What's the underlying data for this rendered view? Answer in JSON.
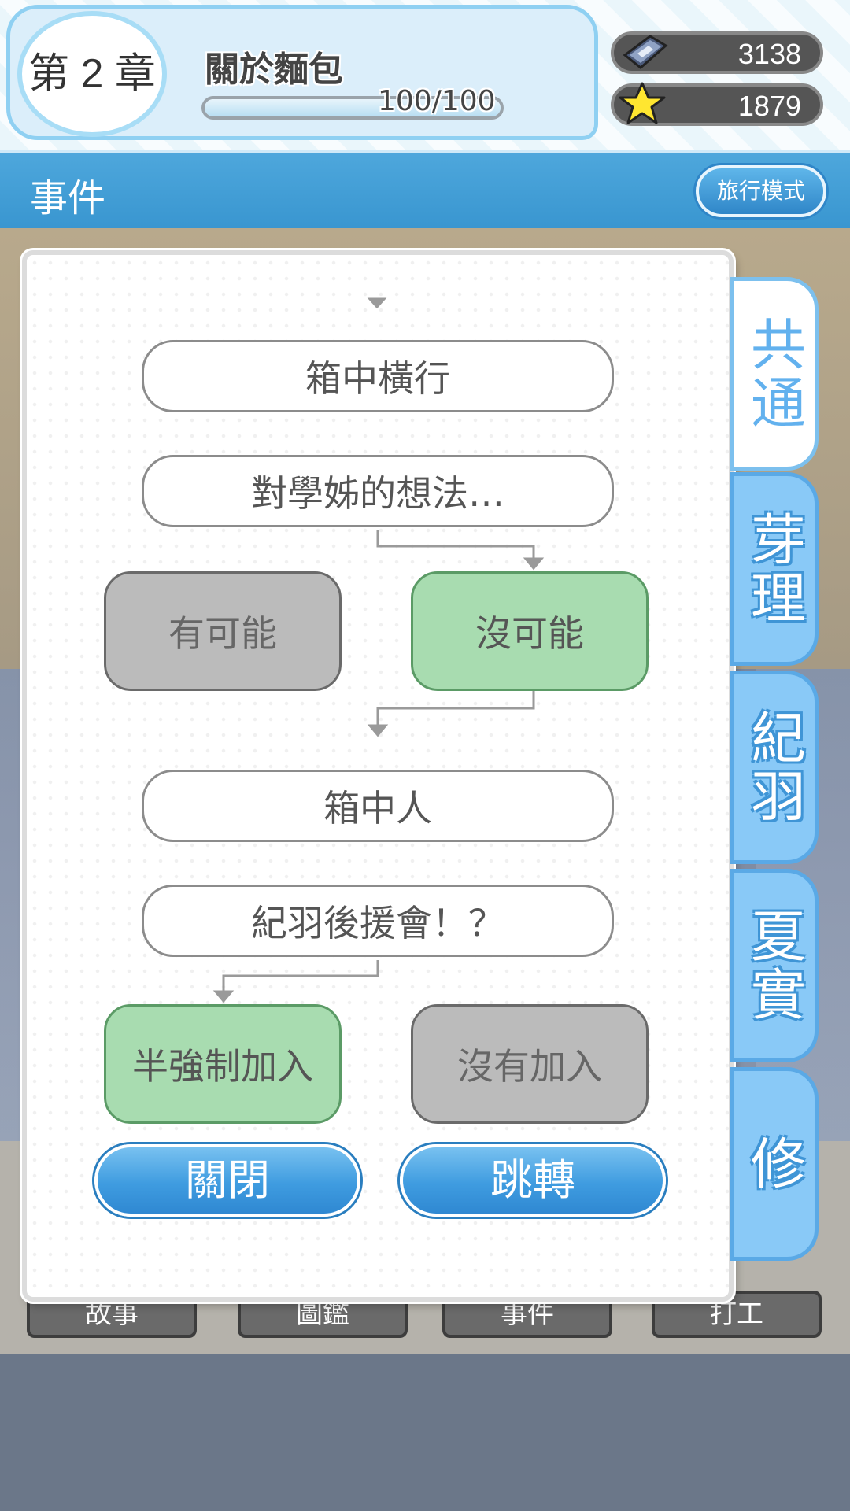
{
  "hud": {
    "chapter": "第 2 章",
    "chapter_title": "關於麵包",
    "progress_text": "100/100",
    "progress_fraction": 1.0,
    "currency": [
      {
        "icon": "ticket-gem-icon",
        "value": "3138"
      },
      {
        "icon": "star-icon",
        "value": "1879"
      }
    ]
  },
  "header": {
    "title": "事件",
    "travel_mode": "旅行模式"
  },
  "flow": {
    "nodes": [
      "箱中橫行",
      "對學姊的想法…",
      "箱中人",
      "紀羽後援會！？"
    ],
    "choices_1": [
      {
        "label": "有可能",
        "selected": false
      },
      {
        "label": "沒可能",
        "selected": true
      }
    ],
    "choices_2": [
      {
        "label": "半強制加入",
        "selected": true
      },
      {
        "label": "沒有加入",
        "selected": false
      }
    ]
  },
  "buttons": {
    "close": "關閉",
    "jump": "跳轉"
  },
  "character_tabs": [
    "共通",
    "芽理",
    "紀羽",
    "夏實",
    "修"
  ],
  "bottom_nav": [
    "故事",
    "圖鑑",
    "事件",
    "打工"
  ],
  "colors": {
    "header_blue": "#3996d0",
    "selected_choice": "#a8dcb0",
    "unselected_choice": "#bbbbbb",
    "tab_blue": "#89c9f7"
  }
}
